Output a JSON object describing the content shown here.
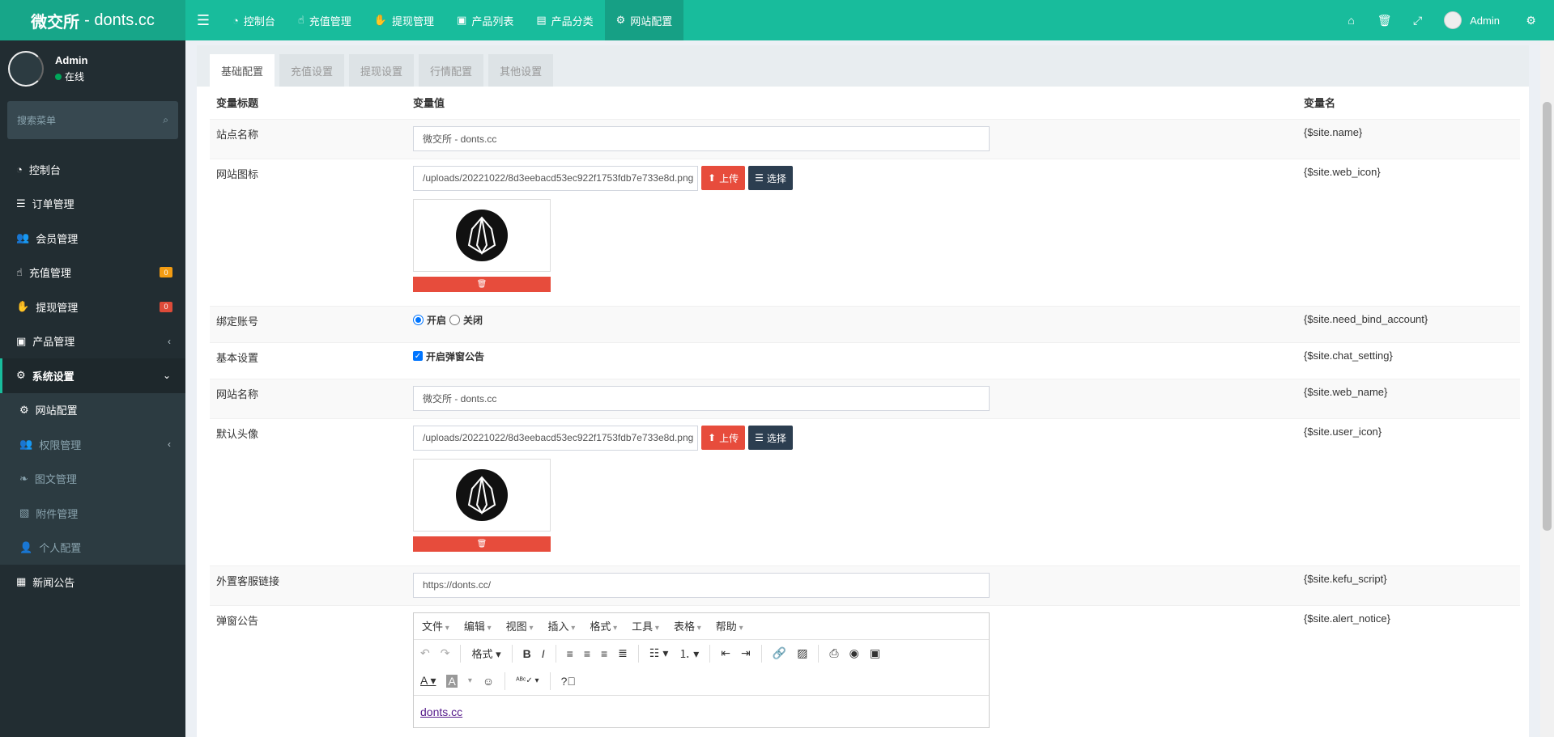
{
  "header": {
    "logo_bold": "微交所",
    "logo_rest": "- donts.cc",
    "nav": [
      {
        "label": "控制台",
        "icon": "dashboard-icon"
      },
      {
        "label": "充值管理",
        "icon": "hand-pointer-icon"
      },
      {
        "label": "提现管理",
        "icon": "hand-lizard-icon"
      },
      {
        "label": "产品列表",
        "icon": "shopping-bag-icon"
      },
      {
        "label": "产品分类",
        "icon": "list-alt-icon"
      },
      {
        "label": "网站配置",
        "icon": "gear-icon"
      }
    ],
    "user": "Admin"
  },
  "sidebar": {
    "user_name": "Admin",
    "status": "在线",
    "search_placeholder": "搜索菜单",
    "items": [
      {
        "label": "控制台"
      },
      {
        "label": "订单管理"
      },
      {
        "label": "会员管理"
      },
      {
        "label": "充值管理",
        "badge": "0",
        "badge_color": "#f39c12"
      },
      {
        "label": "提现管理",
        "badge": "0",
        "badge_color": "#dd4b39"
      },
      {
        "label": "产品管理"
      },
      {
        "label": "系统设置"
      }
    ],
    "sub_items": [
      {
        "label": "网站配置"
      },
      {
        "label": "权限管理"
      },
      {
        "label": "图文管理"
      },
      {
        "label": "附件管理"
      },
      {
        "label": "个人配置"
      }
    ],
    "last_item": "新闻公告"
  },
  "tabs": [
    "基础配置",
    "充值设置",
    "提现设置",
    "行情配置",
    "其他设置"
  ],
  "table": {
    "headers": {
      "title": "变量标题",
      "value": "变量值",
      "name": "变量名"
    },
    "rows": {
      "site_name": {
        "title": "站点名称",
        "value": "微交所 - donts.cc",
        "var": "{$site.name}"
      },
      "web_icon": {
        "title": "网站图标",
        "value": "/uploads/20221022/8d3eebacd53ec922f1753fdb7e733e8d.png",
        "var": "{$site.web_icon}"
      },
      "bind_account": {
        "title": "绑定账号",
        "opt_on": "开启",
        "opt_off": "关闭",
        "var": "{$site.need_bind_account}"
      },
      "basic": {
        "title": "基本设置",
        "check_label": "开启弹窗公告",
        "var": "{$site.chat_setting}"
      },
      "web_name": {
        "title": "网站名称",
        "value": "微交所 -  donts.cc",
        "var": "{$site.web_name}"
      },
      "user_icon": {
        "title": "默认头像",
        "value": "/uploads/20221022/8d3eebacd53ec922f1753fdb7e733e8d.png",
        "var": "{$site.user_icon}"
      },
      "kefu": {
        "title": "外置客服链接",
        "value": "https://donts.cc/",
        "var": "{$site.kefu_script}"
      },
      "alert": {
        "title": "弹窗公告",
        "var": "{$site.alert_notice}",
        "content": "donts.cc"
      }
    },
    "upload_label": "上传",
    "select_label": "选择"
  },
  "editor": {
    "menus": [
      "文件",
      "编辑",
      "视图",
      "插入",
      "格式",
      "工具",
      "表格",
      "帮助"
    ],
    "format_label": "格式"
  }
}
